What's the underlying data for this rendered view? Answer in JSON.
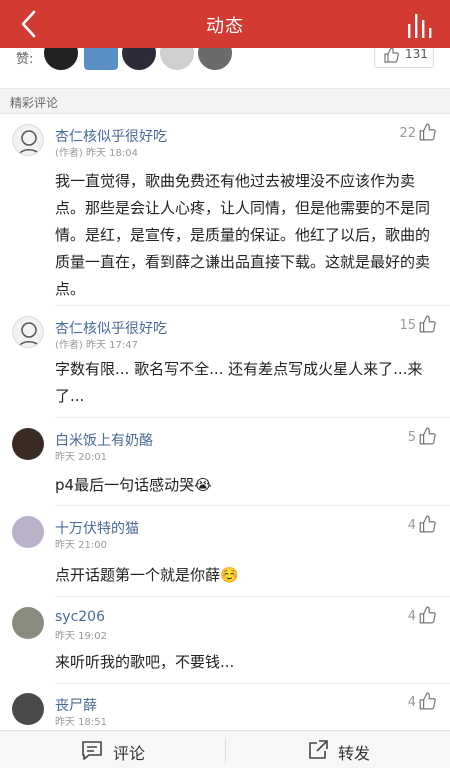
{
  "header": {
    "title": "动态"
  },
  "likes": {
    "label": "赞:",
    "count": "131"
  },
  "section": {
    "title": "精彩评论"
  },
  "comments": [
    {
      "name": "杏仁核似乎很好吃",
      "meta": "(作者) 昨天 18:04",
      "likes": "22",
      "text": "我一直觉得，歌曲免费还有他过去被埋没不应该作为卖点。那些是会让人心疼，让人同情，但是他需要的不是同情。是红，是宣传，是质量的保证。他红了以后，歌曲的质量一直在，看到薛之谦出品直接下载。这就是最好的卖点。"
    },
    {
      "name": "杏仁核似乎很好吃",
      "meta": "(作者) 昨天 17:47",
      "likes": "15",
      "text": "字数有限... 歌名写不全...  还有差点写成火星人来了...来了..."
    },
    {
      "name": "白米饭上有奶酪",
      "meta": "昨天 20:01",
      "likes": "5",
      "text": "p4最后一句话感动哭😭"
    },
    {
      "name": "十万伏特的猫",
      "meta": "昨天 21:00",
      "likes": "4",
      "text": "点开话题第一个就是你薛☺️"
    },
    {
      "name": "syc206",
      "meta": "昨天 19:02",
      "likes": "4",
      "text": "来听听我的歌吧，不要钱..."
    },
    {
      "name": "丧尸薛",
      "meta": "昨天 18:51",
      "likes": "4",
      "text": ""
    }
  ],
  "bottom": {
    "comment_label": "评论",
    "share_label": "转发"
  },
  "colors": {
    "brand": "#d33a31",
    "name": "#4a6a96"
  }
}
